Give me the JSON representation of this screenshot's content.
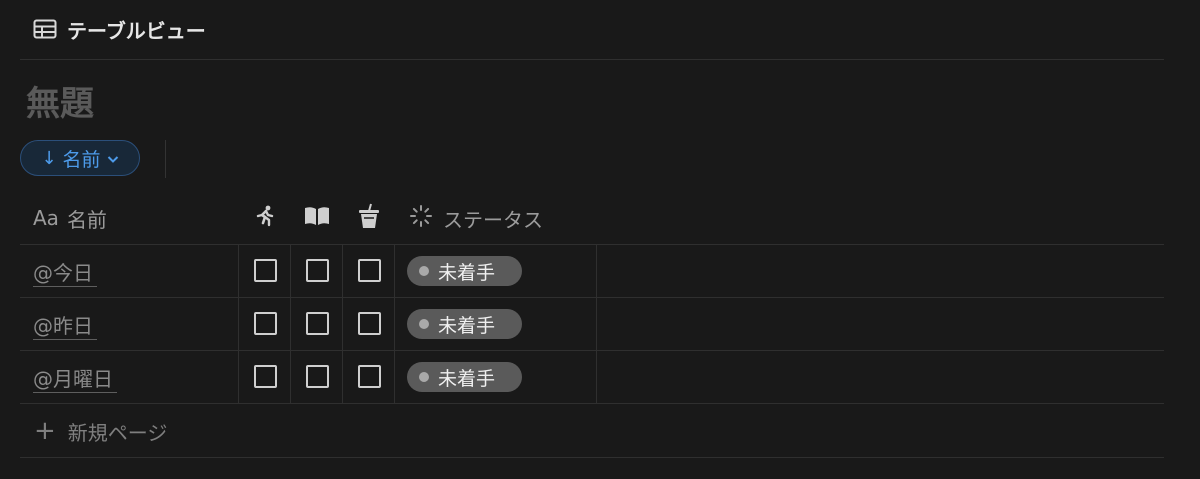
{
  "view": {
    "label": "テーブルビュー",
    "icon": "table-icon"
  },
  "page": {
    "title": "無題"
  },
  "sort": {
    "direction_icon": "arrow-down-icon",
    "label": "名前",
    "chevron_icon": "chevron-down-icon"
  },
  "columns": [
    {
      "icon": "text-type-icon",
      "label": "Aa",
      "name": "名前"
    },
    {
      "icon": "running-person-icon"
    },
    {
      "icon": "book-icon"
    },
    {
      "icon": "drink-cup-icon"
    },
    {
      "icon": "status-loading-icon",
      "label": "ステータス"
    }
  ],
  "rows": [
    {
      "name": "@今日",
      "checks": [
        false,
        false,
        false
      ],
      "status": "未着手"
    },
    {
      "name": "@昨日",
      "checks": [
        false,
        false,
        false
      ],
      "status": "未着手"
    },
    {
      "name": "@月曜日",
      "checks": [
        false,
        false,
        false
      ],
      "status": "未着手"
    }
  ],
  "new_page": {
    "icon": "plus-icon",
    "label": "新規ページ"
  },
  "colors": {
    "background": "#191919",
    "accent": "#4d9bea",
    "status_pill": "#5a5a5a",
    "status_dot": "#a9a9a9"
  }
}
